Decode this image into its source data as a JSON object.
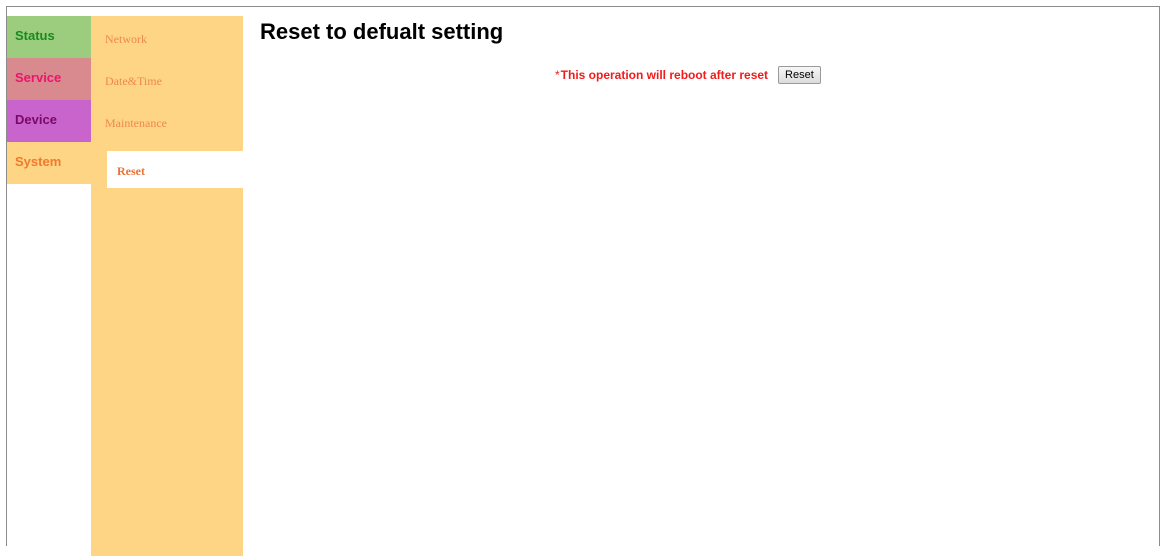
{
  "primary_nav": {
    "items": [
      {
        "label": "Status"
      },
      {
        "label": "Service"
      },
      {
        "label": "Device"
      },
      {
        "label": "System"
      }
    ]
  },
  "secondary_nav": {
    "items": [
      {
        "label": "Network"
      },
      {
        "label": "Date&Time"
      },
      {
        "label": "Maintenance"
      },
      {
        "label": "Reset",
        "active": true
      }
    ]
  },
  "main": {
    "title": "Reset to defualt setting",
    "notice_asterisk": "*",
    "notice_text": "This operation will reboot after reset",
    "reset_button_label": "Reset"
  },
  "colors": {
    "status": "#9ccc7e",
    "service": "#d98a8e",
    "device": "#c864cc",
    "system": "#fed584",
    "warning_text": "#f21b1b"
  }
}
